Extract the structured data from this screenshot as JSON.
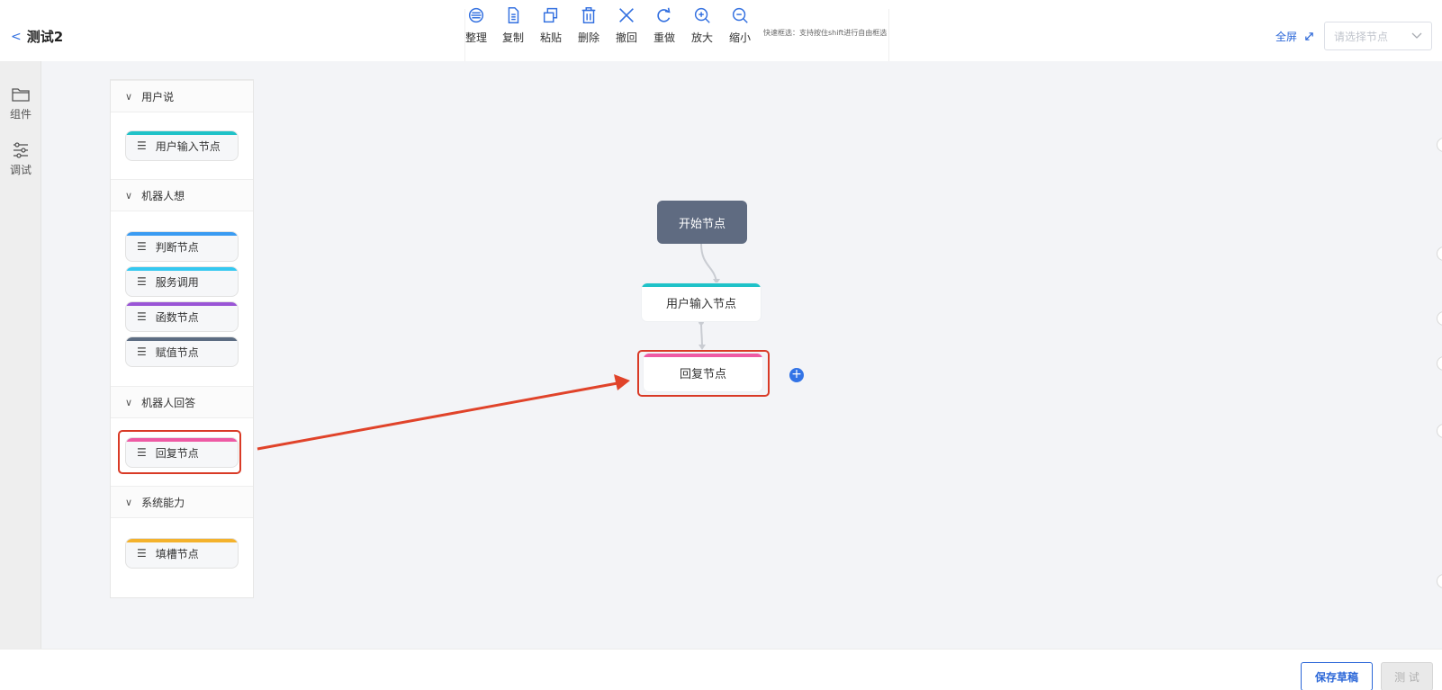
{
  "header": {
    "back_icon": "chevron-left-icon",
    "title": "测试2",
    "toolbar": [
      {
        "id": "arrange",
        "label": "整理",
        "icon": "arrange-icon"
      },
      {
        "id": "copy",
        "label": "复制",
        "icon": "copy-icon"
      },
      {
        "id": "paste",
        "label": "粘贴",
        "icon": "paste-icon"
      },
      {
        "id": "delete",
        "label": "删除",
        "icon": "trash-icon"
      },
      {
        "id": "undo",
        "label": "撤回",
        "icon": "close-icon"
      },
      {
        "id": "redo",
        "label": "重做",
        "icon": "redo-icon"
      },
      {
        "id": "zoom_in",
        "label": "放大",
        "icon": "zoom-in-icon"
      },
      {
        "id": "zoom_out",
        "label": "缩小",
        "icon": "zoom-out-icon"
      }
    ],
    "hint": "快速框选：支持按住shift进行自由框选",
    "fullscreen_label": "全屏",
    "node_select_placeholder": "请选择节点"
  },
  "rail": {
    "items": [
      {
        "label": "组件",
        "icon": "folder-icon"
      },
      {
        "label": "调试",
        "icon": "sliders-icon"
      }
    ]
  },
  "palette": {
    "groups": [
      {
        "title": "用户说",
        "items": [
          {
            "label": "用户输入节点",
            "color": "#1fc2c8"
          }
        ]
      },
      {
        "title": "机器人想",
        "items": [
          {
            "label": "判断节点",
            "color": "#3a9bf2"
          },
          {
            "label": "服务调用",
            "color": "#35c8f0"
          },
          {
            "label": "函数节点",
            "color": "#9a55d6"
          },
          {
            "label": "赋值节点",
            "color": "#5c6c82"
          }
        ]
      },
      {
        "title": "机器人回答",
        "items": [
          {
            "label": "回复节点",
            "color": "#ee5aa4"
          }
        ]
      },
      {
        "title": "系统能力",
        "items": [
          {
            "label": "填槽节点",
            "color": "#f4b22c"
          }
        ]
      }
    ]
  },
  "flow": {
    "start_node": "开始节点",
    "nodes": [
      {
        "label": "用户输入节点",
        "color": "#1fc2c8"
      },
      {
        "label": "回复节点",
        "color": "#ee5aa4"
      }
    ]
  },
  "colors": {
    "accent": "#2b67d8",
    "annotation": "#d93a26",
    "start_node": "#5f6b81"
  },
  "footer": {
    "save_draft": "保存草稿",
    "test": "测 试"
  }
}
